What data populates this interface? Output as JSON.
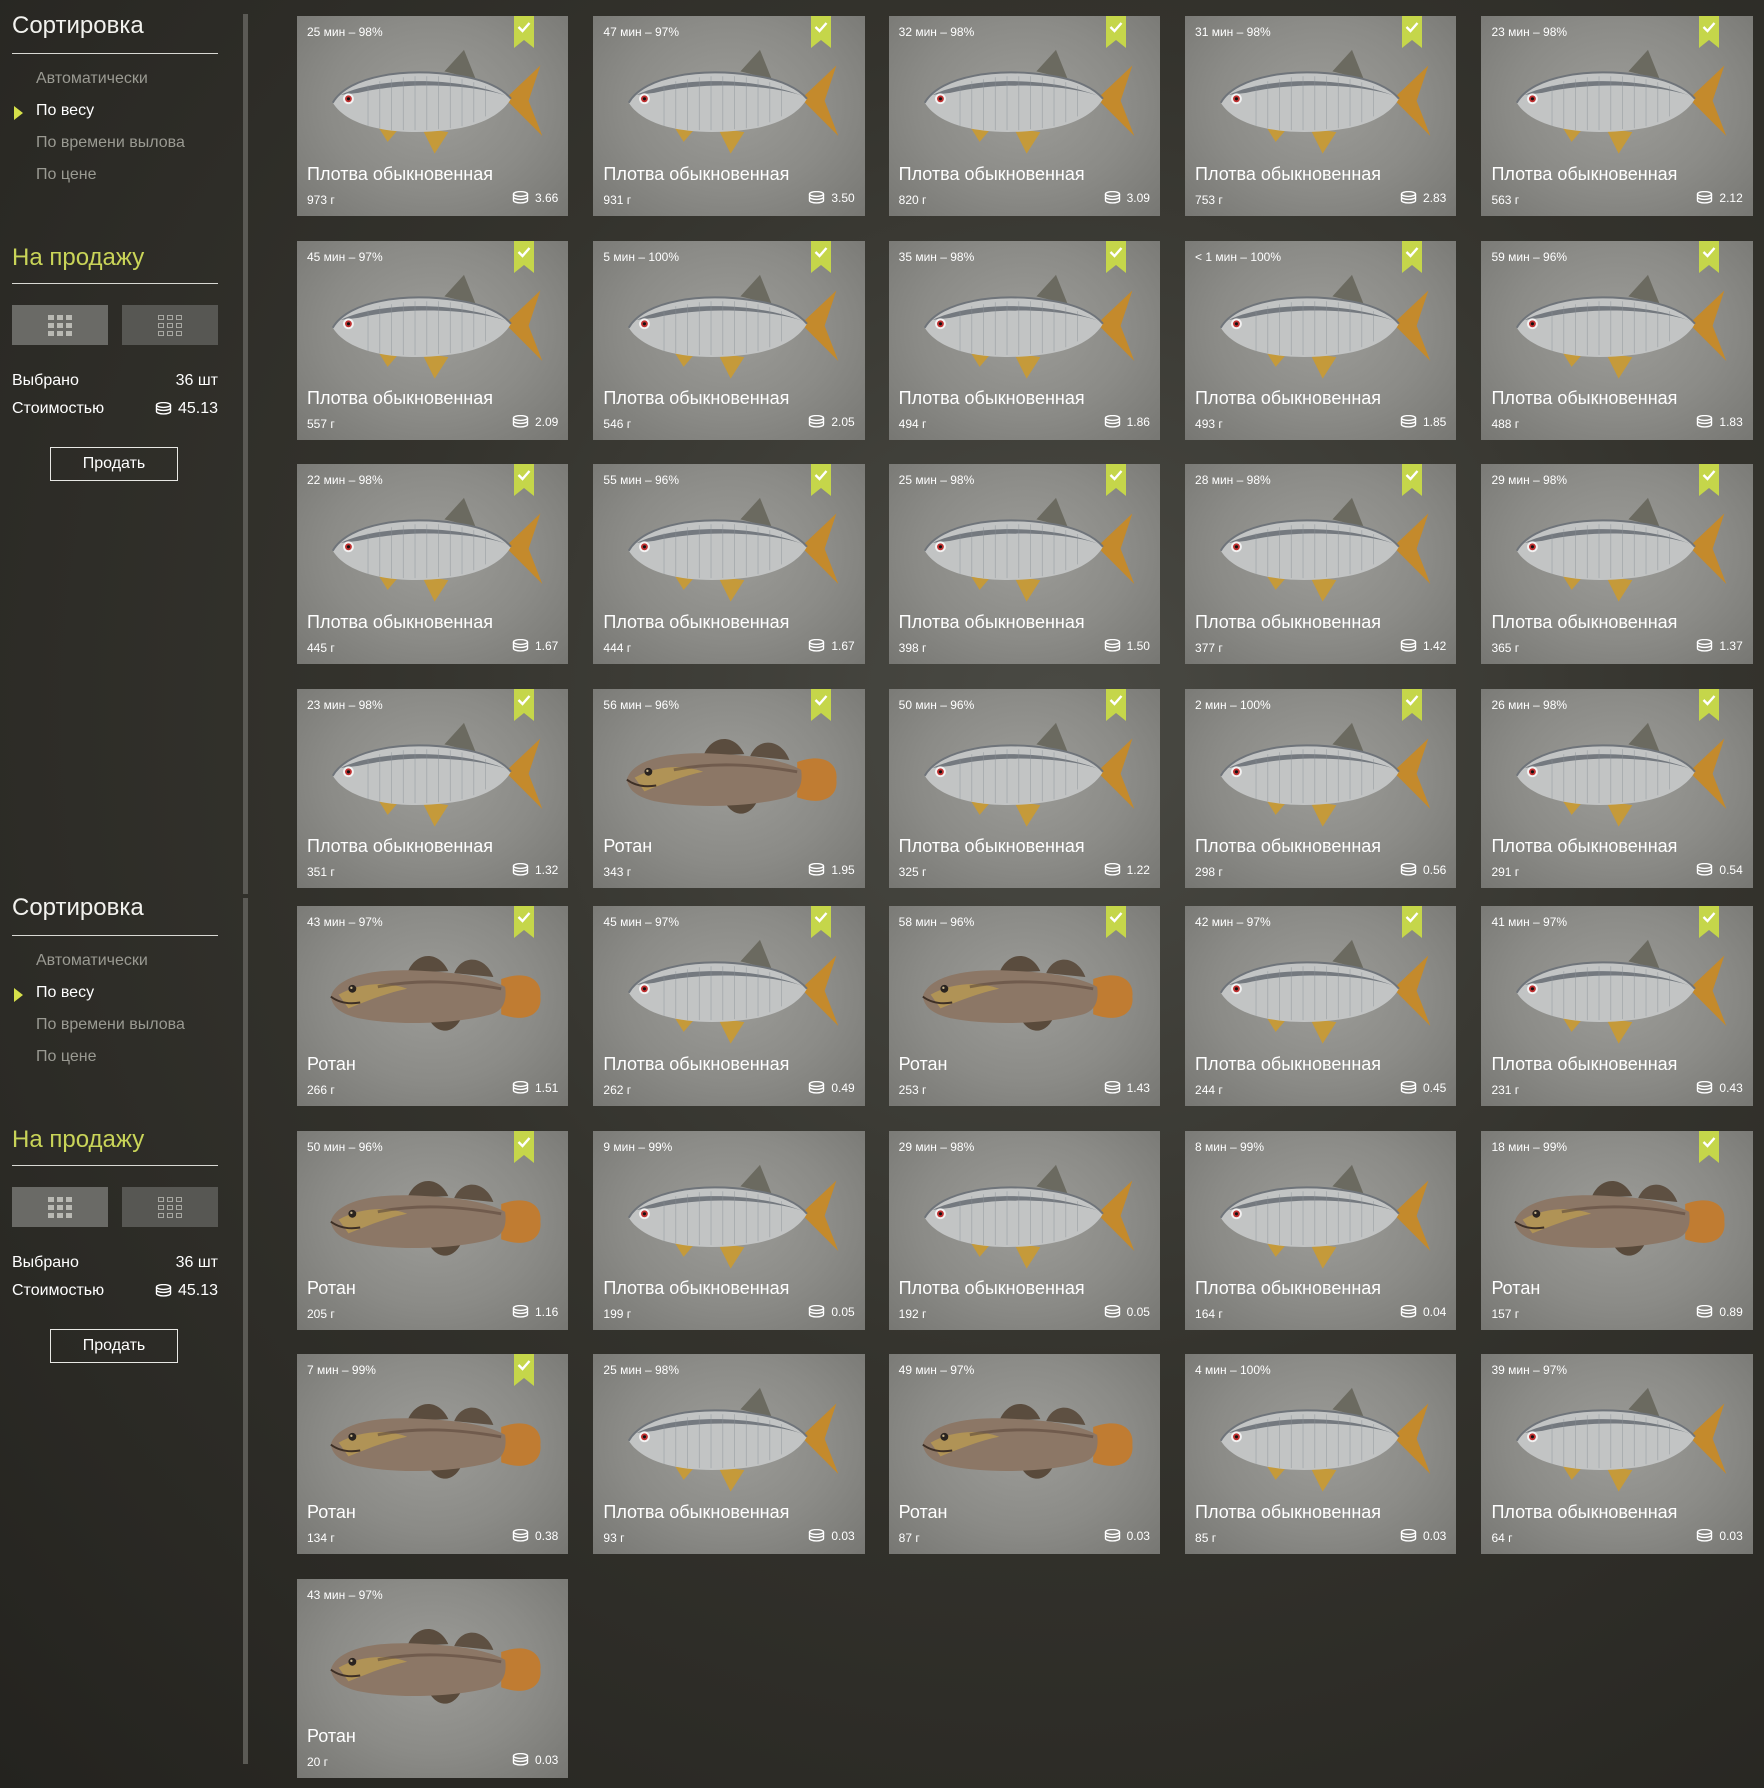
{
  "panels": [
    {
      "sidebar": {
        "sort_title": "Сортировка",
        "sort_options": [
          "Автоматически",
          "По весу",
          "По времени вылова",
          "По цене"
        ],
        "active_sort": "По весу",
        "sale_title": "На продажу",
        "selected_label": "Выбрано",
        "selected_value": "36 шт",
        "cost_label": "Стоимостью",
        "cost_value": "45.13",
        "sell_button": "Продать"
      },
      "cards": [
        {
          "time": "25 мин – 98%",
          "name": "Плотва обыкновенная",
          "weight": "973 г",
          "price": "3.66",
          "species": "roach",
          "checked": true
        },
        {
          "time": "47 мин – 97%",
          "name": "Плотва обыкновенная",
          "weight": "931 г",
          "price": "3.50",
          "species": "roach",
          "checked": true
        },
        {
          "time": "32 мин – 98%",
          "name": "Плотва обыкновенная",
          "weight": "820 г",
          "price": "3.09",
          "species": "roach",
          "checked": true
        },
        {
          "time": "31 мин – 98%",
          "name": "Плотва обыкновенная",
          "weight": "753 г",
          "price": "2.83",
          "species": "roach",
          "checked": true
        },
        {
          "time": "23 мин – 98%",
          "name": "Плотва обыкновенная",
          "weight": "563 г",
          "price": "2.12",
          "species": "roach",
          "checked": true
        },
        {
          "time": "45 мин – 97%",
          "name": "Плотва обыкновенная",
          "weight": "557 г",
          "price": "2.09",
          "species": "roach",
          "checked": true
        },
        {
          "time": "5 мин – 100%",
          "name": "Плотва обыкновенная",
          "weight": "546 г",
          "price": "2.05",
          "species": "roach",
          "checked": true
        },
        {
          "time": "35 мин – 98%",
          "name": "Плотва обыкновенная",
          "weight": "494 г",
          "price": "1.86",
          "species": "roach",
          "checked": true
        },
        {
          "time": "< 1 мин – 100%",
          "name": "Плотва обыкновенная",
          "weight": "493 г",
          "price": "1.85",
          "species": "roach",
          "checked": true
        },
        {
          "time": "59 мин – 96%",
          "name": "Плотва обыкновенная",
          "weight": "488 г",
          "price": "1.83",
          "species": "roach",
          "checked": true
        },
        {
          "time": "22 мин – 98%",
          "name": "Плотва обыкновенная",
          "weight": "445 г",
          "price": "1.67",
          "species": "roach",
          "checked": true
        },
        {
          "time": "55 мин – 96%",
          "name": "Плотва обыкновенная",
          "weight": "444 г",
          "price": "1.67",
          "species": "roach",
          "checked": true
        },
        {
          "time": "25 мин – 98%",
          "name": "Плотва обыкновенная",
          "weight": "398 г",
          "price": "1.50",
          "species": "roach",
          "checked": true
        },
        {
          "time": "28 мин – 98%",
          "name": "Плотва обыкновенная",
          "weight": "377 г",
          "price": "1.42",
          "species": "roach",
          "checked": true
        },
        {
          "time": "29 мин – 98%",
          "name": "Плотва обыкновенная",
          "weight": "365 г",
          "price": "1.37",
          "species": "roach",
          "checked": true
        },
        {
          "time": "23 мин – 98%",
          "name": "Плотва обыкновенная",
          "weight": "351 г",
          "price": "1.32",
          "species": "roach",
          "checked": true
        },
        {
          "time": "56 мин – 96%",
          "name": "Ротан",
          "weight": "343 г",
          "price": "1.95",
          "species": "rotan",
          "checked": true
        },
        {
          "time": "50 мин – 96%",
          "name": "Плотва обыкновенная",
          "weight": "325 г",
          "price": "1.22",
          "species": "roach",
          "checked": true
        },
        {
          "time": "2 мин – 100%",
          "name": "Плотва обыкновенная",
          "weight": "298 г",
          "price": "0.56",
          "species": "roach",
          "checked": true
        },
        {
          "time": "26 мин – 98%",
          "name": "Плотва обыкновенная",
          "weight": "291 г",
          "price": "0.54",
          "species": "roach",
          "checked": true
        }
      ]
    },
    {
      "sidebar": {
        "sort_title": "Сортировка",
        "sort_options": [
          "Автоматически",
          "По весу",
          "По времени вылова",
          "По цене"
        ],
        "active_sort": "По весу",
        "sale_title": "На продажу",
        "selected_label": "Выбрано",
        "selected_value": "36 шт",
        "cost_label": "Стоимостью",
        "cost_value": "45.13",
        "sell_button": "Продать"
      },
      "cards": [
        {
          "time": "43 мин – 97%",
          "name": "Ротан",
          "weight": "266 г",
          "price": "1.51",
          "species": "rotan",
          "checked": true
        },
        {
          "time": "45 мин – 97%",
          "name": "Плотва обыкновенная",
          "weight": "262 г",
          "price": "0.49",
          "species": "roach",
          "checked": true
        },
        {
          "time": "58 мин – 96%",
          "name": "Ротан",
          "weight": "253 г",
          "price": "1.43",
          "species": "rotan",
          "checked": true
        },
        {
          "time": "42 мин – 97%",
          "name": "Плотва обыкновенная",
          "weight": "244 г",
          "price": "0.45",
          "species": "roach",
          "checked": true
        },
        {
          "time": "41 мин – 97%",
          "name": "Плотва обыкновенная",
          "weight": "231 г",
          "price": "0.43",
          "species": "roach",
          "checked": true
        },
        {
          "time": "50 мин – 96%",
          "name": "Ротан",
          "weight": "205 г",
          "price": "1.16",
          "species": "rotan",
          "checked": true
        },
        {
          "time": "9 мин – 99%",
          "name": "Плотва обыкновенная",
          "weight": "199 г",
          "price": "0.05",
          "species": "roach",
          "checked": false
        },
        {
          "time": "29 мин – 98%",
          "name": "Плотва обыкновенная",
          "weight": "192 г",
          "price": "0.05",
          "species": "roach",
          "checked": false
        },
        {
          "time": "8 мин – 99%",
          "name": "Плотва обыкновенная",
          "weight": "164 г",
          "price": "0.04",
          "species": "roach",
          "checked": false
        },
        {
          "time": "18 мин – 99%",
          "name": "Ротан",
          "weight": "157 г",
          "price": "0.89",
          "species": "rotan",
          "checked": true
        },
        {
          "time": "7 мин – 99%",
          "name": "Ротан",
          "weight": "134 г",
          "price": "0.38",
          "species": "rotan",
          "checked": true
        },
        {
          "time": "25 мин – 98%",
          "name": "Плотва обыкновенная",
          "weight": "93 г",
          "price": "0.03",
          "species": "roach",
          "checked": false
        },
        {
          "time": "49 мин – 97%",
          "name": "Ротан",
          "weight": "87 г",
          "price": "0.03",
          "species": "rotan",
          "checked": false
        },
        {
          "time": "4 мин – 100%",
          "name": "Плотва обыкновенная",
          "weight": "85 г",
          "price": "0.03",
          "species": "roach",
          "checked": false
        },
        {
          "time": "39 мин – 97%",
          "name": "Плотва обыкновенная",
          "weight": "64 г",
          "price": "0.03",
          "species": "roach",
          "checked": false
        },
        {
          "time": "43 мин – 97%",
          "name": "Ротан",
          "weight": "20 г",
          "price": "0.03",
          "species": "rotan",
          "checked": false
        }
      ]
    }
  ],
  "colors": {
    "accent": "#c9d458",
    "badge": "#c5d64a",
    "card_bg": "#8b8b87",
    "text": "#ffffff",
    "muted": "#9a9a92"
  },
  "icons": {
    "coin": "coin-stack-icon",
    "badge": "checkmark-bookmark-icon",
    "view_grid": "grid-view-icon",
    "view_list": "list-view-icon",
    "sort_arrow": "triangle-right-icon"
  }
}
